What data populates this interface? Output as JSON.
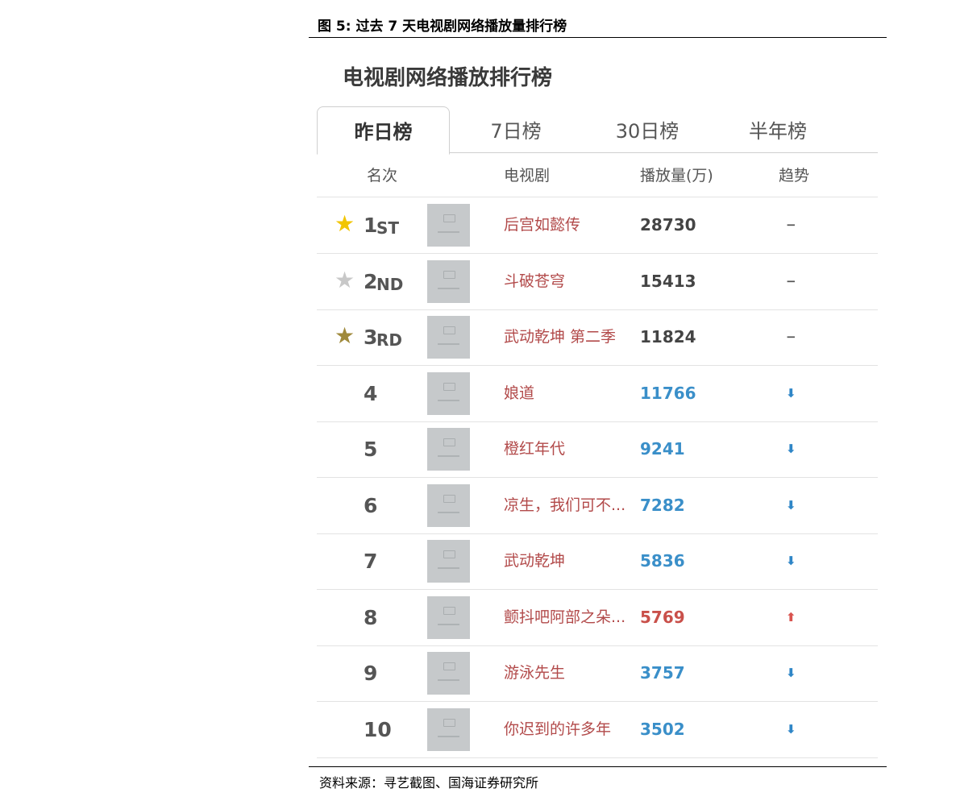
{
  "figure": {
    "caption": "图 5:  过去 7 天电视剧网络播放量排行榜",
    "source": "资料来源：寻艺截图、国海证券研究所"
  },
  "widget": {
    "title": "电视剧网络播放排行榜",
    "tabs": [
      {
        "label": "昨日榜",
        "active": true
      },
      {
        "label": "7日榜",
        "active": false
      },
      {
        "label": "30日榜",
        "active": false
      },
      {
        "label": "半年榜",
        "active": false
      }
    ],
    "headers": {
      "rank": "名次",
      "show": "电视剧",
      "plays": "播放量(万)",
      "trend": "趋势"
    }
  },
  "colors": {
    "gold": "#f2c500",
    "silver": "#c8c8c8",
    "bronze": "#a08a3c",
    "title_red": "#b24a4a",
    "plays_top": "#444444",
    "plays_blue": "#3a8fc9",
    "plays_red": "#c9504a",
    "trend_down": "#2f86c7",
    "trend_up": "#d9534f"
  },
  "rows": [
    {
      "rank": "1",
      "suffix": "ST",
      "star": "gold",
      "title": "后宫如懿传",
      "plays": "28730",
      "trend": "−",
      "trend_dir": "flat"
    },
    {
      "rank": "2",
      "suffix": "ND",
      "star": "silver",
      "title": "斗破苍穹",
      "plays": "15413",
      "trend": "−",
      "trend_dir": "flat"
    },
    {
      "rank": "3",
      "suffix": "RD",
      "star": "bronze",
      "title": "武动乾坤 第二季",
      "plays": "11824",
      "trend": "−",
      "trend_dir": "flat"
    },
    {
      "rank": "4",
      "suffix": "",
      "star": "",
      "title": "娘道",
      "plays": "11766",
      "trend": "⬇",
      "trend_dir": "down"
    },
    {
      "rank": "5",
      "suffix": "",
      "star": "",
      "title": "橙红年代",
      "plays": "9241",
      "trend": "⬇",
      "trend_dir": "down"
    },
    {
      "rank": "6",
      "suffix": "",
      "star": "",
      "title": "凉生，我们可不...",
      "plays": "7282",
      "trend": "⬇",
      "trend_dir": "down"
    },
    {
      "rank": "7",
      "suffix": "",
      "star": "",
      "title": "武动乾坤",
      "plays": "5836",
      "trend": "⬇",
      "trend_dir": "down"
    },
    {
      "rank": "8",
      "suffix": "",
      "star": "",
      "title": "颤抖吧阿部之朵...",
      "plays": "5769",
      "trend": "⬆",
      "trend_dir": "up"
    },
    {
      "rank": "9",
      "suffix": "",
      "star": "",
      "title": "游泳先生",
      "plays": "3757",
      "trend": "⬇",
      "trend_dir": "down"
    },
    {
      "rank": "10",
      "suffix": "",
      "star": "",
      "title": "你迟到的许多年",
      "plays": "3502",
      "trend": "⬇",
      "trend_dir": "down"
    }
  ]
}
